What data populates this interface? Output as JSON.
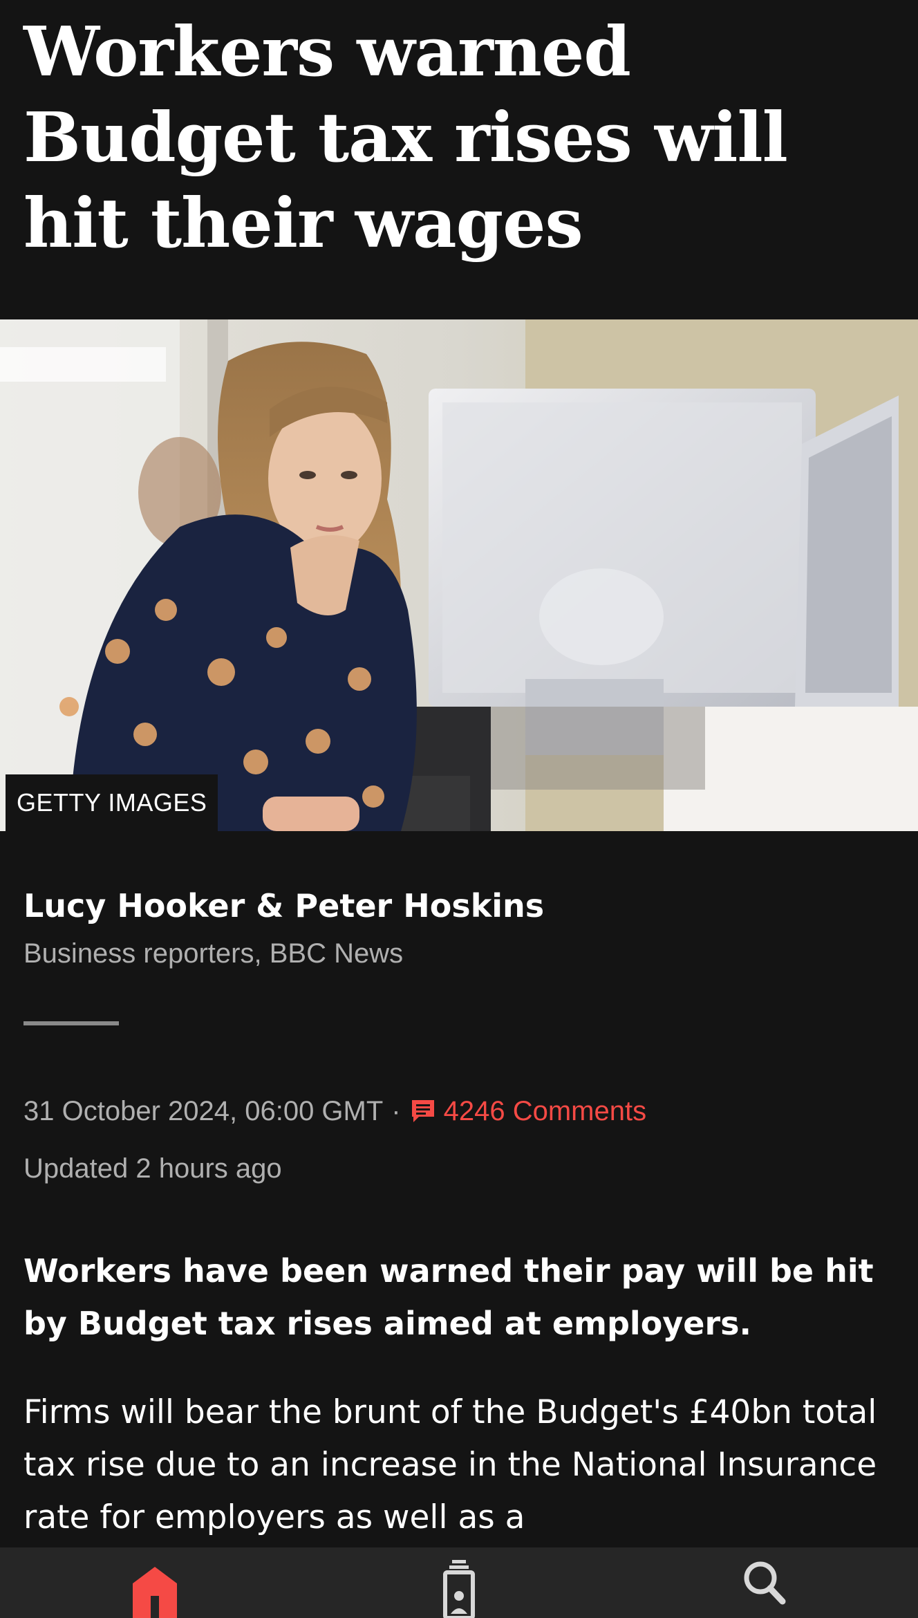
{
  "article": {
    "headline": "Workers warned Budget tax rises will hit their wages",
    "image_credit": "GETTY IMAGES",
    "authors": "Lucy Hooker & Peter Hoskins",
    "role": "Business reporters, BBC News",
    "date": "31 October 2024, 06:00 GMT",
    "separator": "·",
    "comments_label": "4246 Comments",
    "updated": "Updated 2 hours ago",
    "summary": "Workers have been warned their pay will be hit by Budget tax rises aimed at employers.",
    "body": "Firms will bear the brunt of the Budget's £40bn total tax rise due to an increase in the National Insurance rate for employers as well as a"
  },
  "bottom_nav": {
    "items": [
      {
        "icon": "home-icon",
        "active": true
      },
      {
        "icon": "my-news-icon",
        "active": false
      },
      {
        "icon": "search-icon",
        "active": false
      }
    ]
  },
  "colors": {
    "background": "#141414",
    "accent_red": "#f54a45",
    "nav_background": "#262626",
    "muted_text": "#b0b0b0"
  }
}
